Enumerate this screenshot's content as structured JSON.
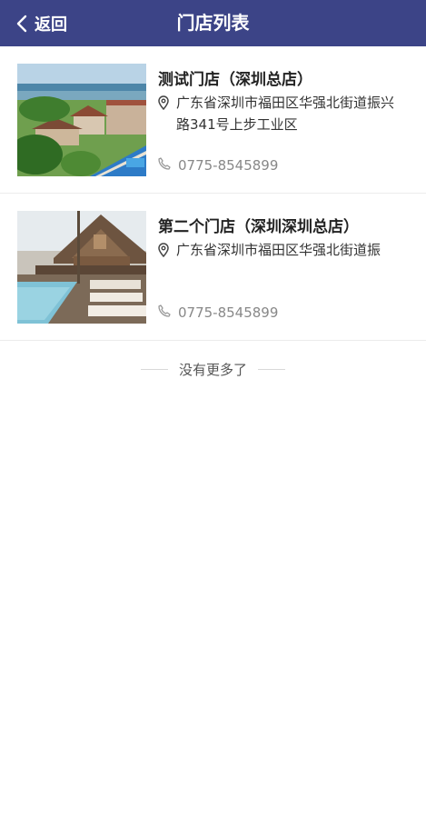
{
  "nav": {
    "back_label": "返回",
    "title": "门店列表"
  },
  "stores": [
    {
      "name": "测试门店（深圳总店）",
      "address": "广东省深圳市福田区华强北街道振兴路341号上步工业区",
      "phone": "0775-8545899",
      "image": "coastal-resort-photo"
    },
    {
      "name": "第二个门店（深圳深圳总店）",
      "address": "广东省深圳市福田区华强北街道振",
      "phone": "0775-8545899",
      "image": "poolside-lodge-photo"
    }
  ],
  "footer": {
    "no_more": "没有更多了"
  },
  "colors": {
    "nav_bg": "#3c4487",
    "nav_text": "#ffffff",
    "phone_text": "#888888"
  }
}
